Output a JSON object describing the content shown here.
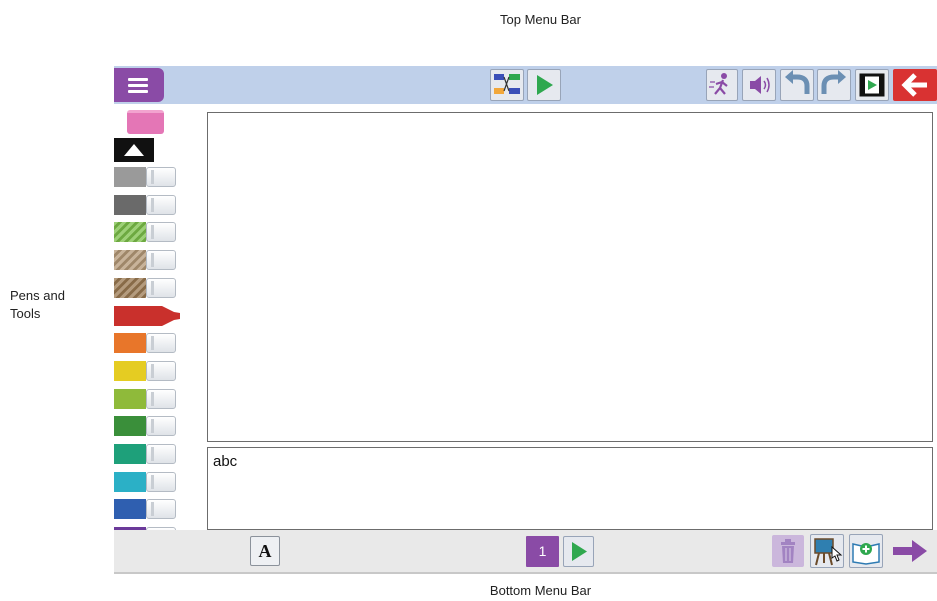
{
  "annotations": {
    "top_menu_bar": "Top Menu Bar",
    "pens_and_tools": "Pens and Tools",
    "bottom_menu_bar": "Bottom Menu Bar"
  },
  "colors": {
    "accent_purple": "#8a4ba6",
    "play_green": "#2fa84f",
    "back_red": "#d93232",
    "top_bar": "#bfd0ea"
  },
  "top_bar": {
    "icons": [
      "menu-icon",
      "sequence-icon",
      "play-icon",
      "walking-person-icon",
      "speaker-icon",
      "undo-icon",
      "redo-icon",
      "film-play-icon",
      "back-arrow-icon"
    ]
  },
  "pens": [
    {
      "name": "eraser",
      "color": "#e476b6"
    },
    {
      "name": "gray-light",
      "color": "#9a9a9a"
    },
    {
      "name": "gray-dark",
      "color": "#6a6a6a"
    },
    {
      "name": "green-texture",
      "color": "#7cc04a"
    },
    {
      "name": "brown-texture-light",
      "color": "#b59a78"
    },
    {
      "name": "brown-texture-dark",
      "color": "#9b7a52"
    },
    {
      "name": "red",
      "color": "#c9302c"
    },
    {
      "name": "orange",
      "color": "#e8762a"
    },
    {
      "name": "yellow",
      "color": "#e5cc22"
    },
    {
      "name": "lime",
      "color": "#8fba3a"
    },
    {
      "name": "green",
      "color": "#3a8f3a"
    },
    {
      "name": "teal",
      "color": "#1ea07a"
    },
    {
      "name": "cyan",
      "color": "#2bb0c6"
    },
    {
      "name": "blue",
      "color": "#2f5fb0"
    },
    {
      "name": "purple",
      "color": "#6b3a9a"
    }
  ],
  "textbox": {
    "value": "abc"
  },
  "bottom_bar": {
    "font_label": "A",
    "page_number": "1",
    "icons": [
      "trash-icon",
      "easel-pointer-icon",
      "add-page-icon",
      "next-arrow-icon"
    ]
  }
}
